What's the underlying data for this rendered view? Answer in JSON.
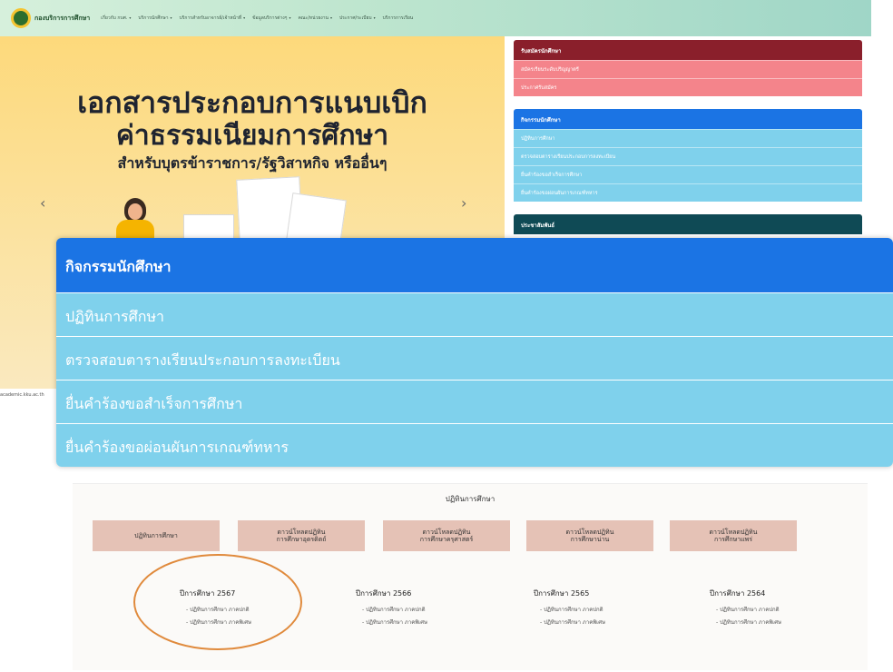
{
  "navbar": {
    "brand": "กองบริการการศึกษา",
    "items": [
      "เกี่ยวกับ กบศ.",
      "บริการนักศึกษา",
      "บริการสำหรับอาจารย์/เจ้าหน้าที่",
      "ข้อมูลบริการต่างๆ",
      "คณะ/หน่วยงาน",
      "ประกาศ/ระเบียบ",
      "บริการการเรียน"
    ],
    "caret": "▾"
  },
  "banner": {
    "title_line1": "เอกสารประกอบการแนบเบิก",
    "title_line2": "ค่าธรรมเนียมการศึกษา",
    "subtitle": "สำหรับบุตรข้าราชการ/รัฐวิสาหกิจ หรืออื่นๆ",
    "prev": "‹",
    "next": "›",
    "url_fragment": "academic.kku.ac.th"
  },
  "panels": {
    "admission": {
      "title": "รับสมัครนักศึกษา",
      "items": [
        "สมัครเรียนระดับปริญญาตรี",
        "ประกาศรับสมัคร"
      ]
    },
    "activities": {
      "title": "กิจกรรมนักศึกษา",
      "items": [
        "ปฏิทินการศึกษา",
        "ตรวจสอบตารางเรียนประกอบการลงทะเบียน",
        "ยื่นคำร้องขอสำเร็จการศึกษา",
        "ยื่นคำร้องขอผ่อนผันการเกณฑ์ทหาร"
      ]
    },
    "pr": {
      "title": "ประชาสัมพันธ์"
    }
  },
  "zoom": {
    "title": "กิจกรรมนักศึกษา",
    "items": [
      "ปฏิทินการศึกษา",
      "ตรวจสอบตารางเรียนประกอบการลงทะเบียน",
      "ยื่นคำร้องขอสำเร็จการศึกษา",
      "ยื่นคำร้องขอผ่อนผันการเกณฑ์ทหาร"
    ]
  },
  "calendar_section": {
    "title": "ปฏิทินการศึกษา",
    "tabs": [
      "ปฏิทินการศึกษา",
      "ดาวน์โหลดปฏิทิน\nการศึกษาอุดรดิตถ์",
      "ดาวน์โหลดปฏิทิน\nการศึกษาครุศาสตร์",
      "ดาวน์โหลดปฏิทิน\nการศึกษาน่าน",
      "ดาวน์โหลดปฏิทิน\nการศึกษาแพร่"
    ],
    "years": [
      {
        "title": "ปีการศึกษา 2567",
        "links": [
          "- ปฏิทินการศึกษา ภาคปกติ",
          "- ปฏิทินการศึกษา ภาคพิเศษ"
        ]
      },
      {
        "title": "ปีการศึกษา 2566",
        "links": [
          "- ปฏิทินการศึกษา ภาคปกติ",
          "- ปฏิทินการศึกษา ภาคพิเศษ"
        ]
      },
      {
        "title": "ปีการศึกษา 2565",
        "links": [
          "- ปฏิทินการศึกษา ภาคปกติ",
          "- ปฏิทินการศึกษา ภาคพิเศษ"
        ]
      },
      {
        "title": "ปีการศึกษา 2564",
        "links": [
          "- ปฏิทินการศึกษา ภาคปกติ",
          "- ปฏิทินการศึกษา ภาคพิเศษ"
        ]
      }
    ]
  },
  "colors": {
    "admission_head": "#8a1f2b",
    "admission_row": "#f4848b",
    "activities_head": "#1b74e4",
    "activities_row": "#7fd1ec",
    "pr_head": "#0f4a55",
    "tab_bg": "#e5c2b6",
    "highlight": "#e08a3c"
  }
}
